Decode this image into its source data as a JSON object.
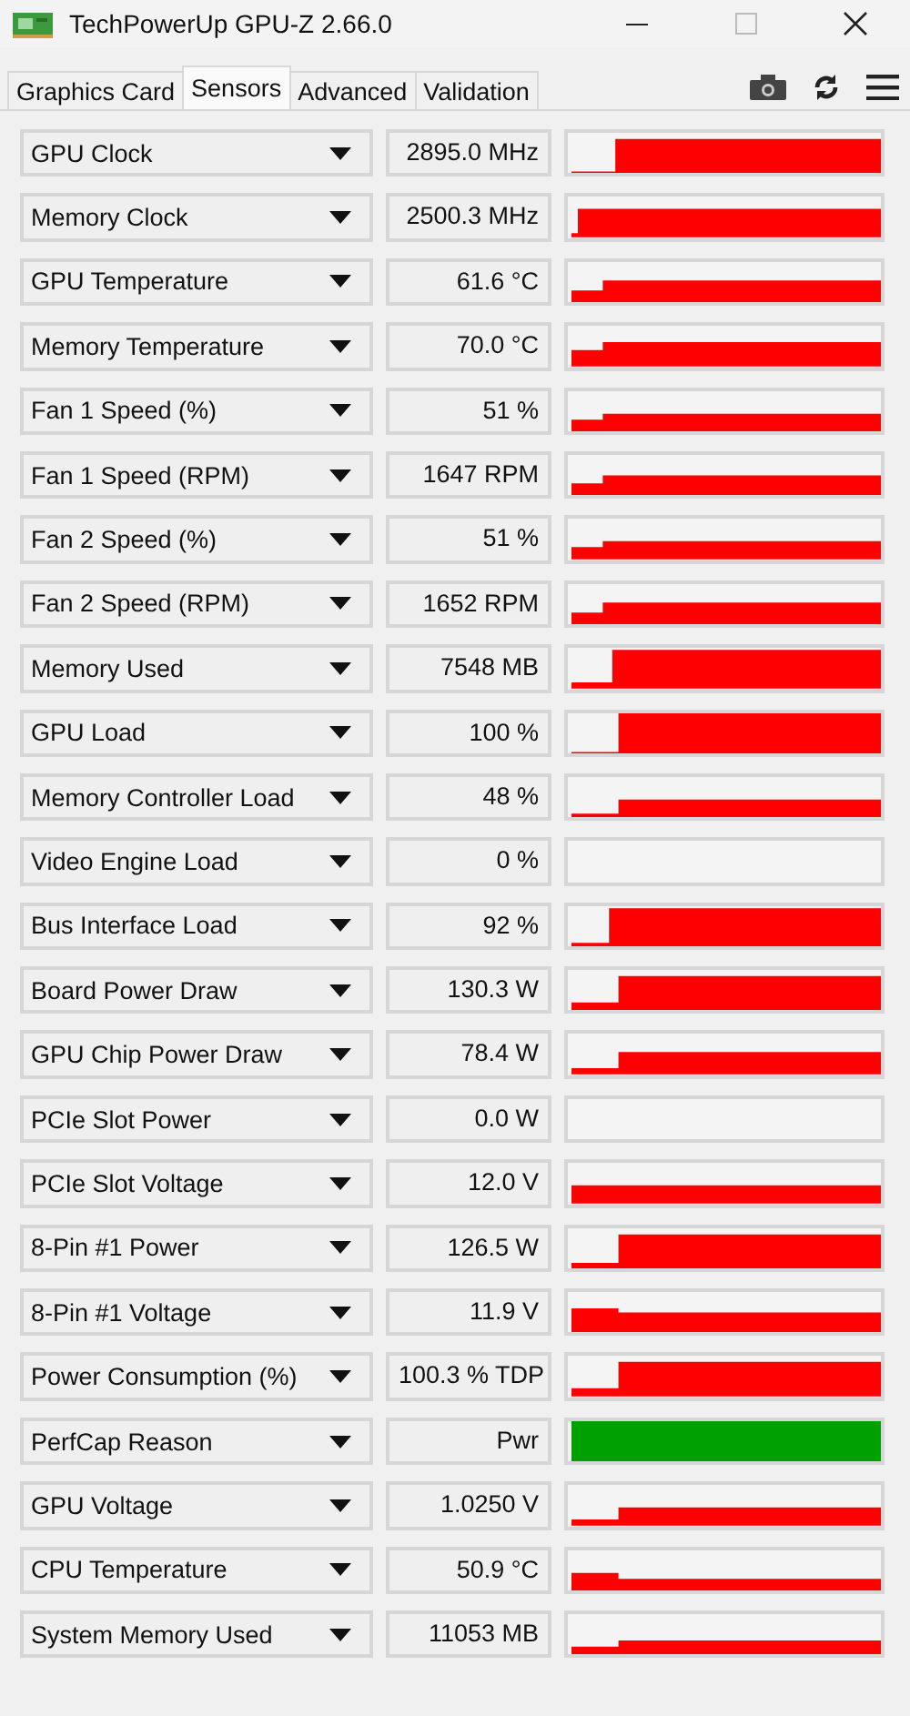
{
  "window": {
    "title": "TechPowerUp GPU-Z 2.66.0"
  },
  "tabs": [
    {
      "label": "Graphics Card",
      "selected": false
    },
    {
      "label": "Sensors",
      "selected": true
    },
    {
      "label": "Advanced",
      "selected": false
    },
    {
      "label": "Validation",
      "selected": false
    }
  ],
  "sensors": [
    {
      "name": "GPU Clock",
      "value": "2895.0 MHz",
      "color": "#ff0000"
    },
    {
      "name": "Memory Clock",
      "value": "2500.3 MHz",
      "color": "#ff0000"
    },
    {
      "name": "GPU Temperature",
      "value": "61.6 °C",
      "color": "#ff0000"
    },
    {
      "name": "Memory Temperature",
      "value": "70.0 °C",
      "color": "#ff0000"
    },
    {
      "name": "Fan 1 Speed (%)",
      "value": "51 %",
      "color": "#ff0000"
    },
    {
      "name": "Fan 1 Speed (RPM)",
      "value": "1647 RPM",
      "color": "#ff0000"
    },
    {
      "name": "Fan 2 Speed (%)",
      "value": "51 %",
      "color": "#ff0000"
    },
    {
      "name": "Fan 2 Speed (RPM)",
      "value": "1652 RPM",
      "color": "#ff0000"
    },
    {
      "name": "Memory Used",
      "value": "7548 MB",
      "color": "#ff0000"
    },
    {
      "name": "GPU Load",
      "value": "100 %",
      "color": "#ff0000"
    },
    {
      "name": "Memory Controller Load",
      "value": "48 %",
      "color": "#ff0000"
    },
    {
      "name": "Video Engine Load",
      "value": "0 %"
    },
    {
      "name": "Bus Interface Load",
      "value": "92 %",
      "color": "#ff0000"
    },
    {
      "name": "Board Power Draw",
      "value": "130.3 W",
      "color": "#ff0000"
    },
    {
      "name": "GPU Chip Power Draw",
      "value": "78.4 W",
      "color": "#ff0000"
    },
    {
      "name": "PCIe Slot Power",
      "value": "0.0 W"
    },
    {
      "name": "PCIe Slot Voltage",
      "value": "12.0 V",
      "color": "#ff0000"
    },
    {
      "name": "8-Pin #1 Power",
      "value": "126.5 W",
      "color": "#ff0000"
    },
    {
      "name": "8-Pin #1 Voltage",
      "value": "11.9 V",
      "color": "#ff0000"
    },
    {
      "name": "Power Consumption (%)",
      "value": "100.3 % TDP",
      "color": "#ff0000"
    },
    {
      "name": "PerfCap Reason",
      "value": "Pwr",
      "color": "#00a000"
    },
    {
      "name": "GPU Voltage",
      "value": "1.0250 V",
      "color": "#ff0000"
    },
    {
      "name": "CPU Temperature",
      "value": "50.9 °C",
      "color": "#ff0000"
    },
    {
      "name": "System Memory Used",
      "value": "11053 MB",
      "color": "#ff0000"
    }
  ]
}
